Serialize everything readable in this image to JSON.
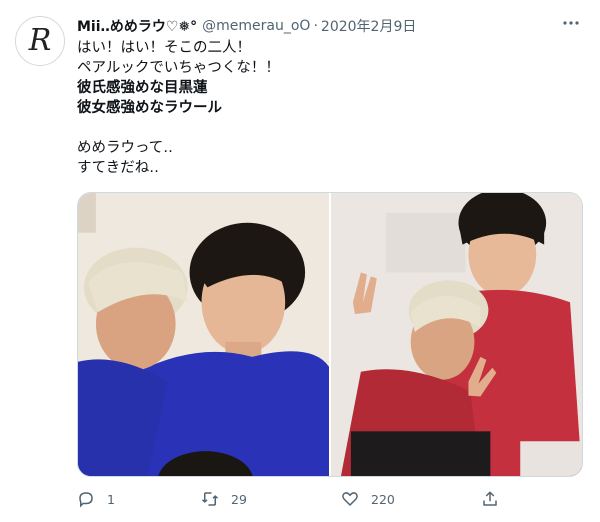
{
  "tweet": {
    "avatar_letter": "R",
    "display_name": "Mii‥めめラウ♡❅°",
    "handle": "@memerau_oO",
    "separator": "·",
    "date": "2020年2月9日",
    "lines": [
      "はい！はい！そこの二人！",
      "ペアルックでいちゃつくな！！",
      "彼氏感強めな目黒蓮",
      "彼女感強めなラウール",
      "めめラウって‥",
      "すてきだね‥"
    ],
    "media": {
      "left_photo_icon": "photo-two-men-blue-shirts",
      "right_photo_icon": "photo-two-men-red-shirts"
    },
    "actions": {
      "reply_count": "1",
      "retweet_count": "29",
      "like_count": "220"
    }
  },
  "colors": {
    "text": "#0f1419",
    "secondary": "#536471",
    "border": "#cfd9de",
    "blue_shirt": "#2a33b8",
    "red_shirt": "#c4303e"
  }
}
